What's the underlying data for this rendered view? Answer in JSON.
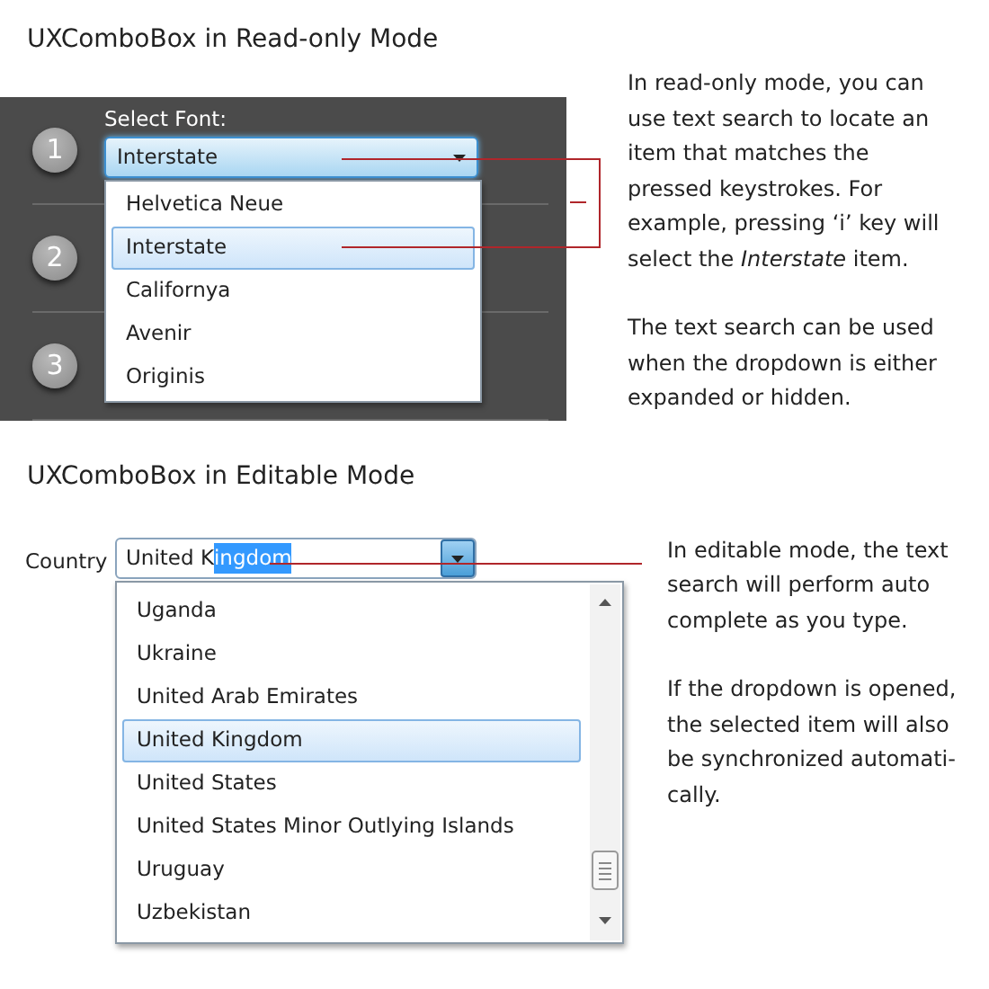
{
  "readonly_section": {
    "title": "UXComboBox in Read-only Mode",
    "steps": [
      "1",
      "2",
      "3"
    ],
    "combo_label": "Select Font:",
    "combo_value": "Interstate",
    "expanded": true,
    "items": [
      {
        "label": "Helvetica Neue",
        "selected": false
      },
      {
        "label": "Interstate",
        "selected": true
      },
      {
        "label": "Californya",
        "selected": false
      },
      {
        "label": "Avenir",
        "selected": false
      },
      {
        "label": "Originis",
        "selected": false
      }
    ],
    "description": [
      "In read-only mode, you can\nuse text search to locate an\nitem that matches the\npressed keystrokes. For\nexample, pressing ‘i’ key will\nselect the *Interstate* item.",
      "The text search can be used\nwhen the dropdown is either\nexpanded or hidden."
    ]
  },
  "editable_section": {
    "title": "UXComboBox in Editable Mode",
    "field_label": "Country",
    "typed_text": "United K",
    "completed_text": "ingdom",
    "expanded": true,
    "items": [
      {
        "label": "Uganda",
        "selected": false
      },
      {
        "label": "Ukraine",
        "selected": false
      },
      {
        "label": "United Arab Emirates",
        "selected": false
      },
      {
        "label": "United Kingdom",
        "selected": true
      },
      {
        "label": "United States",
        "selected": false
      },
      {
        "label": "United States Minor Outlying Islands",
        "selected": false
      },
      {
        "label": "Uruguay",
        "selected": false
      },
      {
        "label": "Uzbekistan",
        "selected": false
      }
    ],
    "description": [
      "In editable mode, the text\nsearch will perform auto\ncomplete as you type.",
      "If the dropdown is opened,\nthe selected item will also\nbe synchronized automati-\ncally."
    ]
  }
}
